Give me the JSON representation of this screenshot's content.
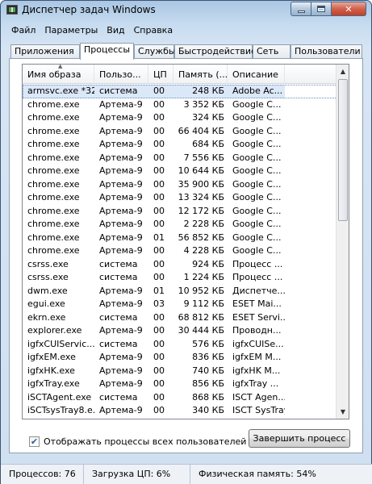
{
  "window": {
    "title": "Диспетчер задач Windows",
    "icon": "task-manager-icon",
    "caption_buttons": [
      "minimize-icon",
      "maximize-icon",
      "close-icon"
    ]
  },
  "menu": [
    "Файл",
    "Параметры",
    "Вид",
    "Справка"
  ],
  "tabs": [
    {
      "label": "Приложения",
      "active": false
    },
    {
      "label": "Процессы",
      "active": true
    },
    {
      "label": "Службы",
      "active": false
    },
    {
      "label": "Быстродействие",
      "active": false
    },
    {
      "label": "Сеть",
      "active": false
    },
    {
      "label": "Пользователи",
      "active": false
    }
  ],
  "table": {
    "columns": [
      "Имя образа",
      "Пользо...",
      "ЦП",
      "Память (...",
      "Описание"
    ],
    "sorted_column": "Имя образа",
    "rows": [
      {
        "name": "armsvc.exe *32",
        "user": "система",
        "cpu": "00",
        "mem": "248 КБ",
        "desc": "Adobe Ac...",
        "selected": true
      },
      {
        "name": "chrome.exe",
        "user": "Артема-9",
        "cpu": "00",
        "mem": "3 352 КБ",
        "desc": "Google C..."
      },
      {
        "name": "chrome.exe",
        "user": "Артема-9",
        "cpu": "00",
        "mem": "324 КБ",
        "desc": "Google C..."
      },
      {
        "name": "chrome.exe",
        "user": "Артема-9",
        "cpu": "00",
        "mem": "66 404 КБ",
        "desc": "Google C..."
      },
      {
        "name": "chrome.exe",
        "user": "Артема-9",
        "cpu": "00",
        "mem": "684 КБ",
        "desc": "Google C..."
      },
      {
        "name": "chrome.exe",
        "user": "Артема-9",
        "cpu": "00",
        "mem": "7 556 КБ",
        "desc": "Google C..."
      },
      {
        "name": "chrome.exe",
        "user": "Артема-9",
        "cpu": "00",
        "mem": "10 644 КБ",
        "desc": "Google C..."
      },
      {
        "name": "chrome.exe",
        "user": "Артема-9",
        "cpu": "00",
        "mem": "35 900 КБ",
        "desc": "Google C..."
      },
      {
        "name": "chrome.exe",
        "user": "Артема-9",
        "cpu": "00",
        "mem": "13 324 КБ",
        "desc": "Google C..."
      },
      {
        "name": "chrome.exe",
        "user": "Артема-9",
        "cpu": "00",
        "mem": "12 172 КБ",
        "desc": "Google C..."
      },
      {
        "name": "chrome.exe",
        "user": "Артема-9",
        "cpu": "00",
        "mem": "2 228 КБ",
        "desc": "Google C..."
      },
      {
        "name": "chrome.exe",
        "user": "Артема-9",
        "cpu": "01",
        "mem": "56 852 КБ",
        "desc": "Google C..."
      },
      {
        "name": "chrome.exe",
        "user": "Артема-9",
        "cpu": "00",
        "mem": "4 228 КБ",
        "desc": "Google C..."
      },
      {
        "name": "csrss.exe",
        "user": "система",
        "cpu": "00",
        "mem": "924 КБ",
        "desc": "Процесс ..."
      },
      {
        "name": "csrss.exe",
        "user": "система",
        "cpu": "00",
        "mem": "1 224 КБ",
        "desc": "Процесс ..."
      },
      {
        "name": "dwm.exe",
        "user": "Артема-9",
        "cpu": "01",
        "mem": "10 952 КБ",
        "desc": "Диспетче..."
      },
      {
        "name": "egui.exe",
        "user": "Артема-9",
        "cpu": "03",
        "mem": "9 112 КБ",
        "desc": "ESET Mai..."
      },
      {
        "name": "ekrn.exe",
        "user": "система",
        "cpu": "00",
        "mem": "68 812 КБ",
        "desc": "ESET Servi..."
      },
      {
        "name": "explorer.exe",
        "user": "Артема-9",
        "cpu": "00",
        "mem": "30 444 КБ",
        "desc": "Проводн..."
      },
      {
        "name": "igfxCUIServic...",
        "user": "система",
        "cpu": "00",
        "mem": "576 КБ",
        "desc": "igfxCUISe..."
      },
      {
        "name": "igfxEM.exe",
        "user": "Артема-9",
        "cpu": "00",
        "mem": "836 КБ",
        "desc": "igfxEM M..."
      },
      {
        "name": "igfxHK.exe",
        "user": "Артема-9",
        "cpu": "00",
        "mem": "740 КБ",
        "desc": "igfxHK M..."
      },
      {
        "name": "igfxTray.exe",
        "user": "Артема-9",
        "cpu": "00",
        "mem": "856 КБ",
        "desc": "igfxTray ..."
      },
      {
        "name": "iSCTAgent.exe",
        "user": "система",
        "cpu": "00",
        "mem": "868 КБ",
        "desc": "ISCT Agen..."
      },
      {
        "name": "iSCTsysTray8.e...",
        "user": "Артема-9",
        "cpu": "00",
        "mem": "340 КБ",
        "desc": "ISCT SysTray"
      }
    ]
  },
  "show_all_users": {
    "label": "Отображать процессы всех пользователей",
    "checked": true
  },
  "end_process_label": "Завершить процесс",
  "status": {
    "processes": "Процессов: 76",
    "cpu": "Загрузка ЦП: 6%",
    "memory": "Физическая память: 54%"
  }
}
